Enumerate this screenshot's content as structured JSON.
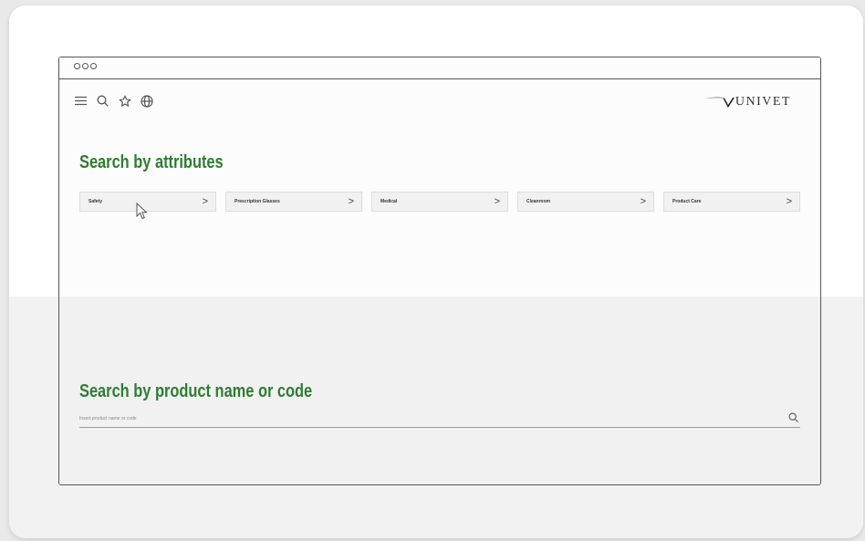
{
  "brand": {
    "logo_text": "UNIVET"
  },
  "nav": {
    "icons": [
      "menu-icon",
      "search-icon",
      "star-icon",
      "globe-icon"
    ]
  },
  "attributes_section": {
    "title": "Search by attributes",
    "items": [
      {
        "label": "Safety"
      },
      {
        "label": "Prescription Glasses"
      },
      {
        "label": "Medical"
      },
      {
        "label": "Cleanroom"
      },
      {
        "label": "Product Care"
      }
    ]
  },
  "product_search": {
    "title": "Search by product name or code",
    "placeholder": "Insert product name or code"
  },
  "colors": {
    "accent": "#2e7d32",
    "frame": "#555555",
    "button_bg": "#f1f1f1"
  }
}
